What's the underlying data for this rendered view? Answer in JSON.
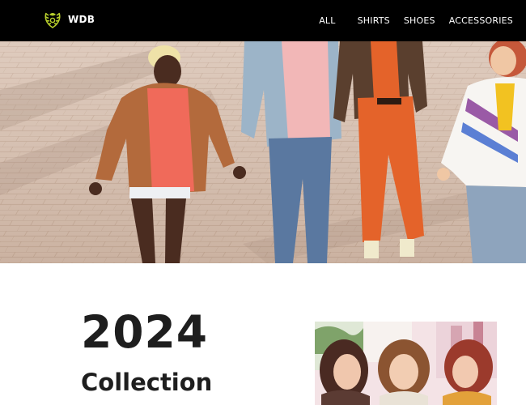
{
  "header": {
    "brand": "WDB",
    "logo_icon": "leaf-wreath-icon",
    "nav": [
      "ALL",
      "SHIRTS",
      "SHOES",
      "ACCESSORIES"
    ]
  },
  "hero": {
    "image": "friends-walking-photo"
  },
  "collection": {
    "year": "2024",
    "title": "Collection",
    "promo_image": "three-women-smiling-photo"
  },
  "colors": {
    "header_bg": "#000000",
    "logo_accent": "#b9d12c",
    "heading": "#1e1e1e"
  }
}
